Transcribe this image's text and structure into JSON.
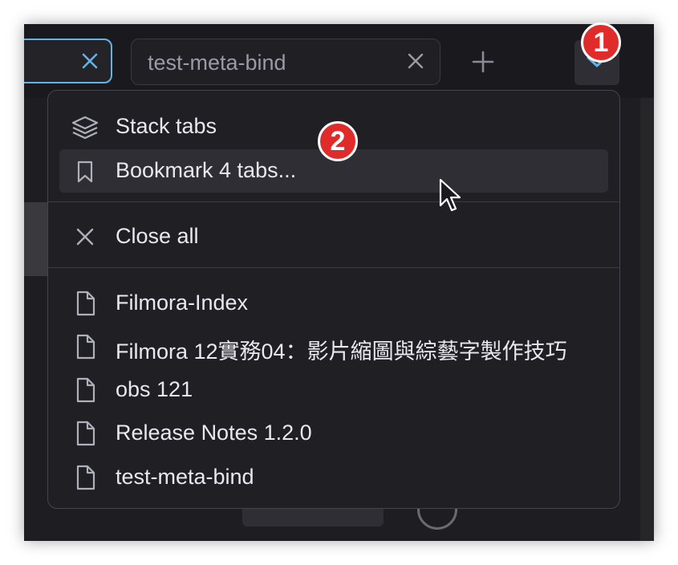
{
  "tabs": [
    {
      "label": "",
      "active": true
    },
    {
      "label": "test-meta-bind",
      "active": false
    }
  ],
  "toolbar": {
    "new_tab_icon": "plus-icon",
    "dropdown_icon": "chevron-down-icon"
  },
  "badges": {
    "first": "1",
    "second": "2"
  },
  "menu": {
    "actions": [
      {
        "label": "Stack tabs",
        "icon": "layers-icon"
      },
      {
        "label": "Bookmark 4 tabs...",
        "icon": "bookmark-icon"
      }
    ],
    "close_all": {
      "label": "Close all",
      "icon": "close-icon"
    },
    "open_tabs": [
      {
        "label": "Filmora-Index",
        "icon": "file-icon"
      },
      {
        "label": "Filmora 12實務04：影片縮圖與綜藝字製作技巧",
        "icon": "file-icon"
      },
      {
        "label": "obs 121",
        "icon": "file-icon"
      },
      {
        "label": "Release Notes 1.2.0",
        "icon": "file-icon"
      },
      {
        "label": "test-meta-bind",
        "icon": "file-icon"
      }
    ]
  },
  "colors": {
    "accent": "#63b3e6",
    "badge": "#e02b2b",
    "menu_bg": "#1f1f24",
    "hover_bg": "#2e2e34",
    "text": "#e8e8ee"
  }
}
